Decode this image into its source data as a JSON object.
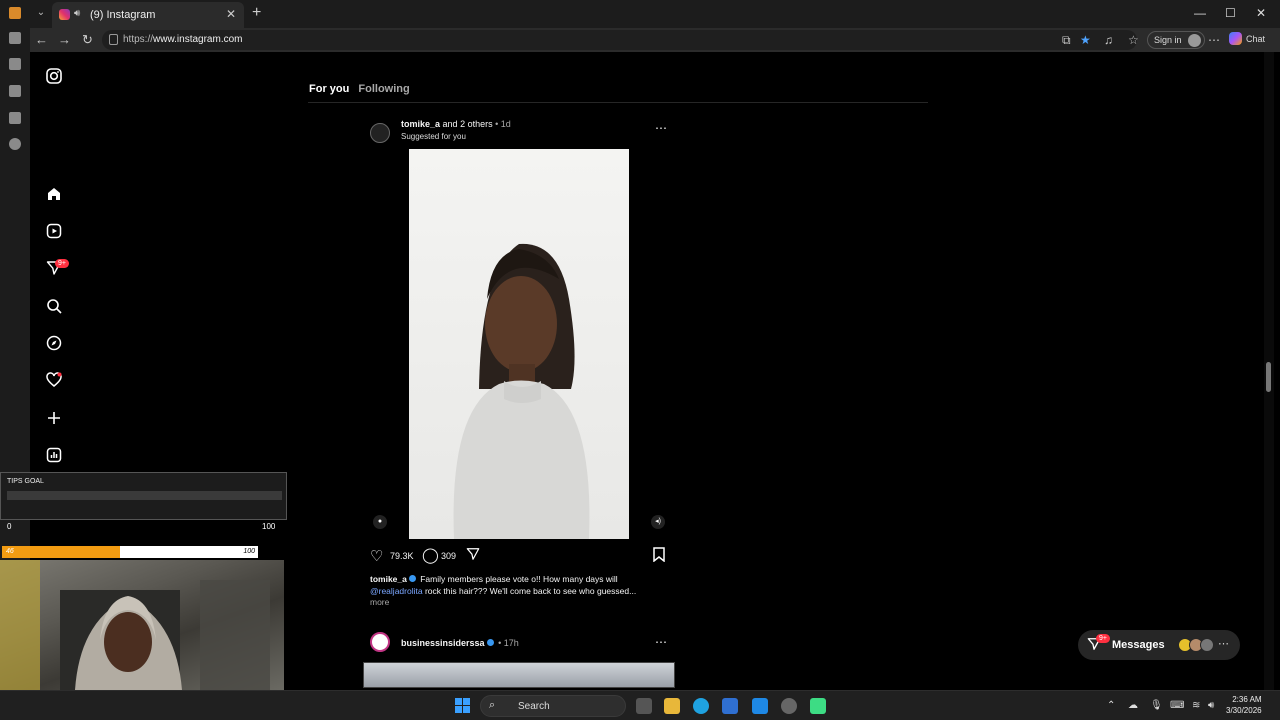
{
  "browser": {
    "tab_title": "(9) Instagram",
    "url_prefix": "https://",
    "url_host": "www.instagram.com",
    "sign_in_label": "Sign in",
    "chat_label": "Chat"
  },
  "sidebar": {
    "notification_badge": "9+"
  },
  "feed_tabs": {
    "for_you": "For you",
    "following": "Following"
  },
  "post1": {
    "username": "tomike_a",
    "coauthors": "and 2 others",
    "age": "1d",
    "suggested": "Suggested for you",
    "likes": "79.3K",
    "comments": "309",
    "caption_user": "tomike_a",
    "caption_text": "Family members please vote o!! How many days will",
    "caption_mention": "@realjadrolita",
    "caption_rest": "rock this hair??? We'll come back to see who guessed...",
    "more_label": "more"
  },
  "post2": {
    "username": "businessinsiderssa",
    "age": "17h"
  },
  "messages": {
    "label": "Messages",
    "badge": "9+"
  },
  "overlay": {
    "tips_title": "TIPS GOAL",
    "tips_min": "0",
    "tips_max": "100",
    "goal_current": "46",
    "goal_max": "100",
    "goal_progress": 0.46
  },
  "taskbar": {
    "search_label": "Search",
    "time": "2:36 AM",
    "date": "3/30/2026"
  },
  "colors": {
    "accent_red": "#ff3040",
    "verified_blue": "#3897f0",
    "goal_orange": "#f39c12"
  }
}
